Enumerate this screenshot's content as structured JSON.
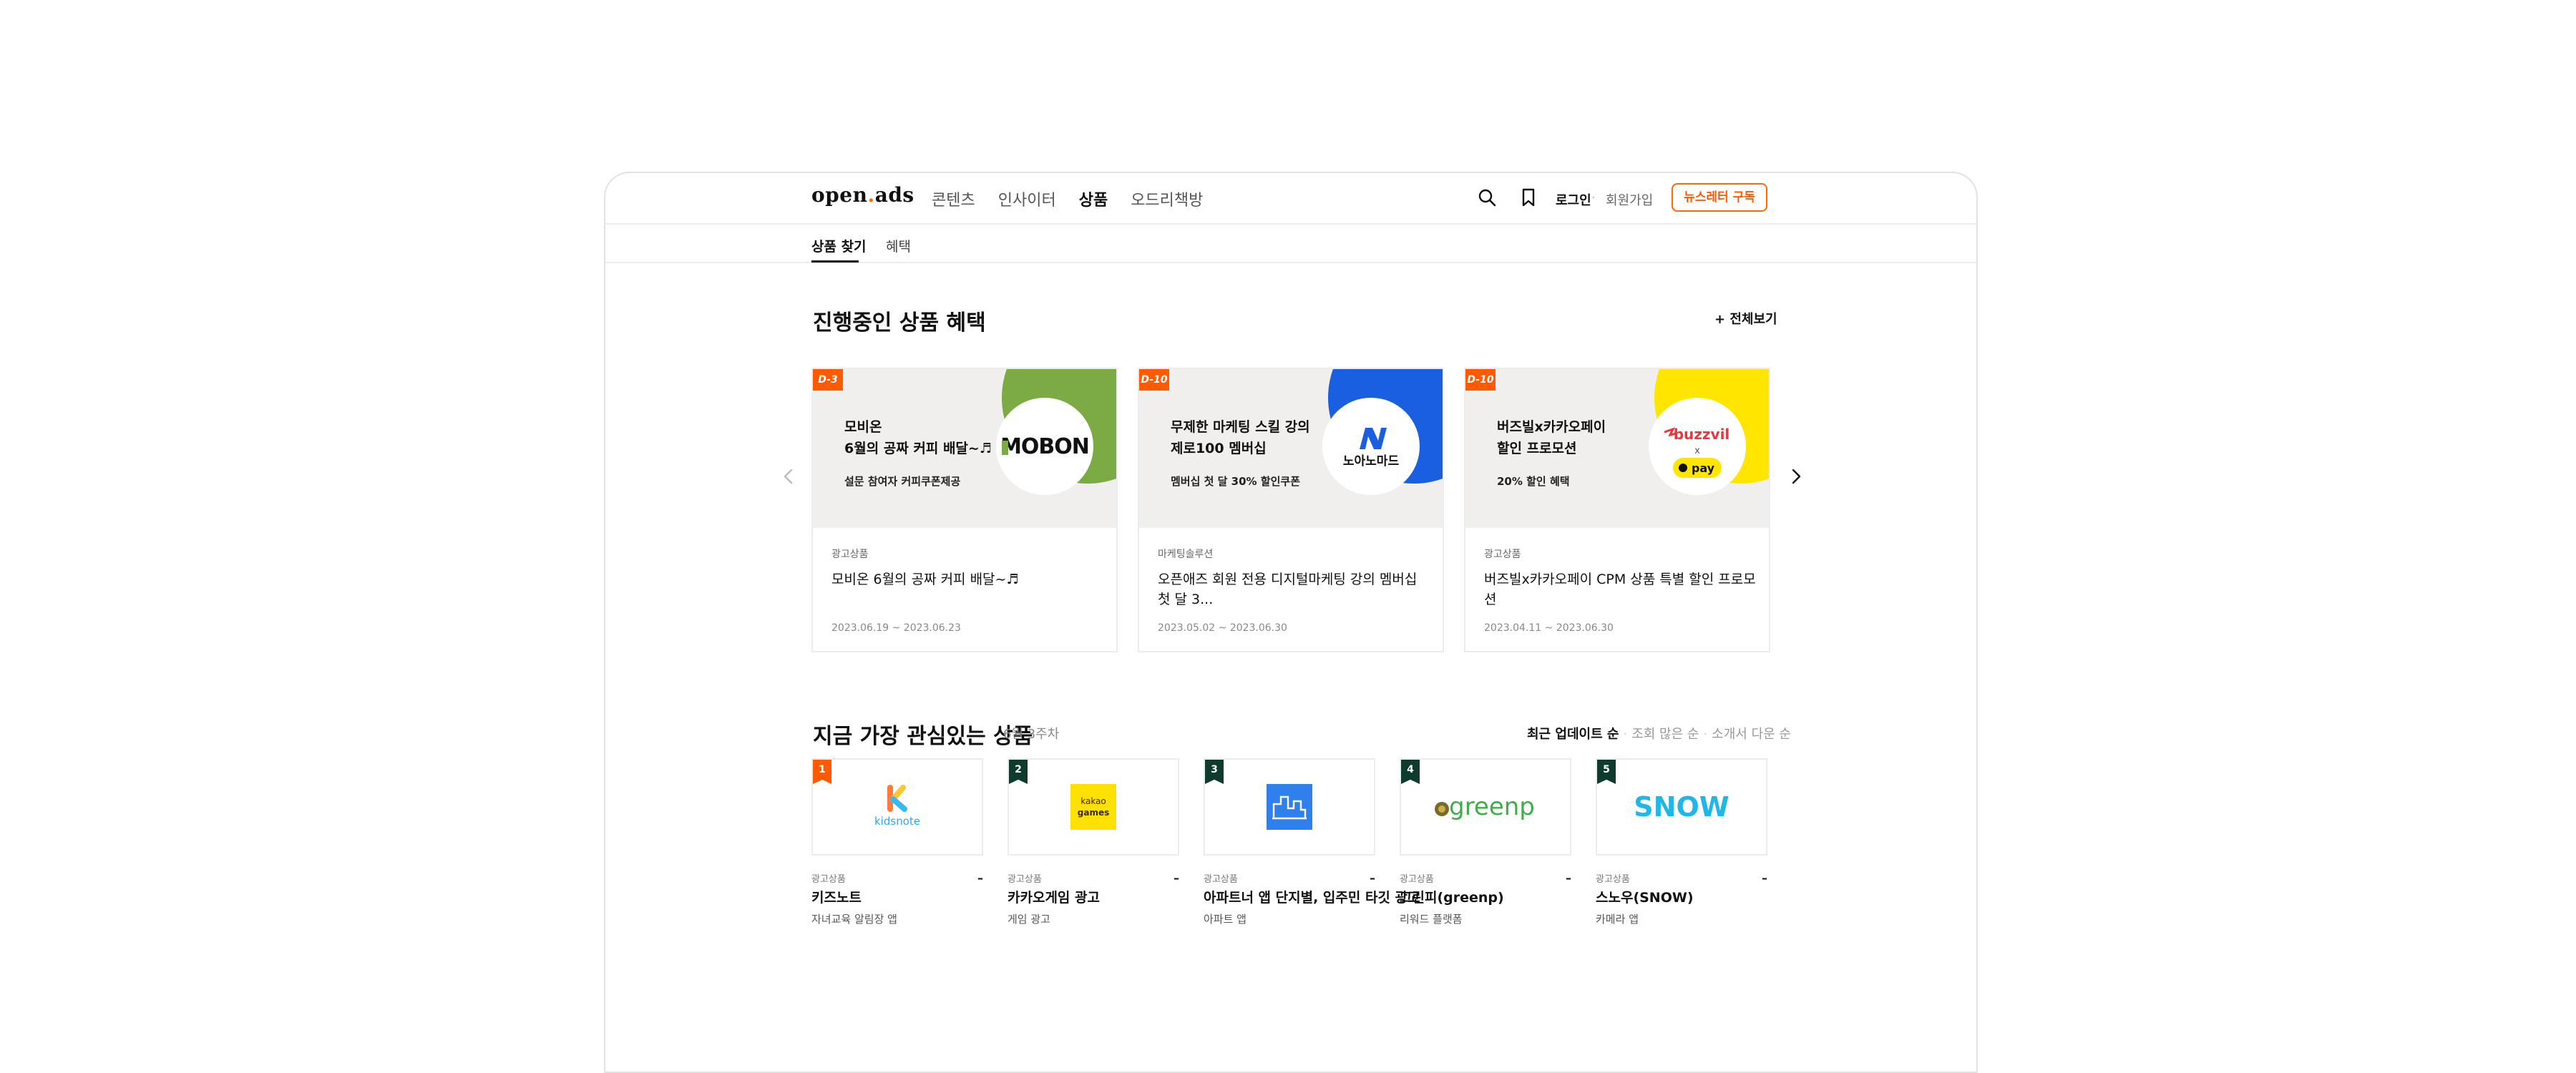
{
  "header": {
    "logo_left": "open",
    "logo_dot": ".",
    "logo_right": "ads",
    "nav": [
      "콘텐츠",
      "인사이터",
      "상품",
      "오드리책방"
    ],
    "login": "로그인",
    "separator": "·",
    "signup": "회원가입",
    "newsletter": "뉴스레터 구독"
  },
  "subnav": {
    "tabs": [
      "상품 찾기",
      "혜택"
    ]
  },
  "benefits": {
    "title": "진행중인 상품 혜택",
    "see_all": "+ 전체보기",
    "cards": [
      {
        "dday": "D-3",
        "banner_line1": "모비온",
        "banner_line2": "6월의 공짜 커피 배달~♬",
        "banner_sub": "설문 참여자 커피쿠폰제공",
        "brand": "MOBON",
        "corner_color": "#7cab45",
        "category": "광고상품",
        "title": "모비온 6월의 공짜 커피 배달~♬",
        "date": "2023.06.19 ~ 2023.06.23"
      },
      {
        "dday": "D-10",
        "banner_line1": "무제한 마케팅 스킬 강의",
        "banner_line2": "제로100 멤버십",
        "banner_sub": "멤버십 첫 달 30% 할인쿠폰",
        "brand": "노아노마드",
        "corner_color": "#1a5fe0",
        "category": "마케팅솔루션",
        "title": "오픈애즈 회원 전용 디지털마케팅 강의 멤버십 첫 달 3...",
        "date": "2023.05.02 ~ 2023.06.30"
      },
      {
        "dday": "D-10",
        "banner_line1": "버즈빌x카카오페이",
        "banner_line2": "할인 프로모션",
        "banner_sub": "20% 할인 혜택",
        "brand": "buzzvil",
        "brand_x": "x",
        "brand_pay": "pay",
        "corner_color": "#ffe600",
        "category": "광고상품",
        "title": "버즈빌x카카오페이 CPM 상품 특별 할인 프로모션",
        "date": "2023.04.11 ~ 2023.06.30"
      }
    ]
  },
  "popular": {
    "title": "지금 가장 관심있는 상품",
    "subtitle": "6월 3주차",
    "sorts": [
      "최근 업데이트 순",
      "조회 많은 순",
      "소개서 다운 순"
    ],
    "items": [
      {
        "rank": "1",
        "rank_color": "#ff5a00",
        "category": "광고상품",
        "name": "키즈노트",
        "desc": "자녀교육 알림장 앱",
        "logo_text": "kidsnote"
      },
      {
        "rank": "2",
        "rank_color": "#0f3b2e",
        "category": "광고상품",
        "name": "카카오게임 광고",
        "desc": "게임 광고",
        "logo_text": "kakao games"
      },
      {
        "rank": "3",
        "rank_color": "#0f3b2e",
        "category": "광고상품",
        "name": "아파트너 앱 단지별, 입주민 타깃 광고",
        "desc": "아파트 앱",
        "logo_text": ""
      },
      {
        "rank": "4",
        "rank_color": "#0f3b2e",
        "category": "광고상품",
        "name": "그린피(greenp)",
        "desc": "리워드 플랫폼",
        "logo_text": "greenp"
      },
      {
        "rank": "5",
        "rank_color": "#0f3b2e",
        "category": "광고상품",
        "name": "스노우(SNOW)",
        "desc": "카메라 앱",
        "logo_text": "SNOW"
      }
    ],
    "dash": "–"
  }
}
